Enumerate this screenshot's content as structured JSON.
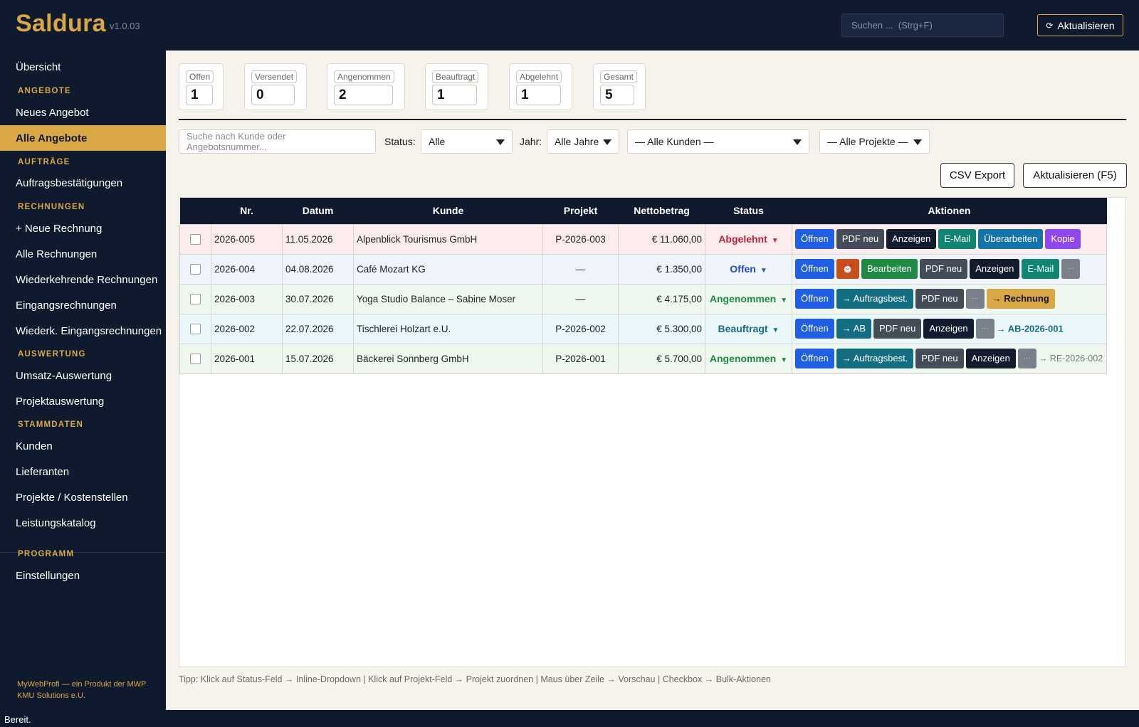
{
  "app": {
    "brand": "Saldura",
    "version": "v1.0.03"
  },
  "topbar": {
    "search_placeholder": "Suchen ...  (Strg+F)",
    "refresh_label": "Aktualisieren"
  },
  "sidebar": {
    "overview": "Übersicht",
    "sec_angebote": "ANGEBOTE",
    "new_offer": "Neues Angebot",
    "all_offers": "Alle Angebote",
    "sec_auftraege": "AUFTRÄGE",
    "order_confirmations": "Auftragsbestätigungen",
    "sec_rechnungen": "RECHNUNGEN",
    "new_invoice": "+ Neue Rechnung",
    "all_invoices": "Alle Rechnungen",
    "recurring_invoices": "Wiederkehrende Rechnungen",
    "incoming_invoices": "Eingangsrechnungen",
    "recurring_incoming": "Wiederk. Eingangsrechnungen",
    "sec_auswertung": "AUSWERTUNG",
    "revenue_report": "Umsatz-Auswertung",
    "project_report": "Projektauswertung",
    "sec_stammdaten": "STAMMDATEN",
    "customers": "Kunden",
    "suppliers": "Lieferanten",
    "projects": "Projekte / Kostenstellen",
    "catalog": "Leistungskatalog",
    "sec_programm": "PROGRAMM",
    "settings": "Einstellungen",
    "credit": "MyWebProfi — ein Produkt der MWP KMU Solutions e.U."
  },
  "stats": [
    {
      "label": "Offen",
      "value": "1"
    },
    {
      "label": "Versendet",
      "value": "0"
    },
    {
      "label": "Angenommen",
      "value": "2"
    },
    {
      "label": "Beauftragt",
      "value": "1"
    },
    {
      "label": "Abgelehnt",
      "value": "1"
    },
    {
      "label": "Gesamt",
      "value": "5"
    }
  ],
  "filters": {
    "search_placeholder": "Suche nach Kunde oder Angebotsnummer...",
    "status_label": "Status:",
    "status_value": "Alle",
    "year_label": "Jahr:",
    "year_value": "Alle Jahre",
    "customer_value": "— Alle Kunden —",
    "project_value": "— Alle Projekte —"
  },
  "toolbar": {
    "csv_export": "CSV Export",
    "refresh": "Aktualisieren  (F5)"
  },
  "table": {
    "headers": [
      "",
      "Nr.",
      "Datum",
      "Kunde",
      "Projekt",
      "Nettobetrag",
      "Status",
      "Aktionen"
    ],
    "rows": [
      {
        "nr": "2026-005",
        "date": "11.05.2026",
        "customer": "Alpenblick Tourismus GmbH",
        "project": "P-2026-003",
        "amount": "€ 11.060,00",
        "status": "Abgelehnt",
        "actions": [
          "Öffnen",
          "PDF neu",
          "Anzeigen",
          "E-Mail",
          "Überarbeiten",
          "Kopie"
        ]
      },
      {
        "nr": "2026-004",
        "date": "04.08.2026",
        "customer": "Café Mozart KG",
        "project": "—",
        "amount": "€ 1.350,00",
        "status": "Offen",
        "actions": [
          "Öffnen",
          "⏰",
          "Bearbeiten",
          "PDF neu",
          "Anzeigen",
          "E-Mail",
          "···"
        ]
      },
      {
        "nr": "2026-003",
        "date": "30.07.2026",
        "customer": "Yoga Studio Balance – Sabine Moser",
        "project": "—",
        "amount": "€ 4.175,00",
        "status": "Angenommen",
        "actions": [
          "Öffnen",
          "→ Auftragsbest.",
          "PDF neu",
          "···",
          "→ Rechnung"
        ]
      },
      {
        "nr": "2026-002",
        "date": "22.07.2026",
        "customer": "Tischlerei Holzart e.U.",
        "project": "P-2026-002",
        "amount": "€ 5.300,00",
        "status": "Beauftragt",
        "actions": [
          "Öffnen",
          "→ AB",
          "PDF neu",
          "Anzeigen",
          "···"
        ],
        "ref": "→ AB-2026-001"
      },
      {
        "nr": "2026-001",
        "date": "15.07.2026",
        "customer": "Bäckerei Sonnberg GmbH",
        "project": "P-2026-001",
        "amount": "€ 5.700,00",
        "status": "Angenommen",
        "actions": [
          "Öffnen",
          "→ Auftragsbest.",
          "PDF neu",
          "Anzeigen",
          "···"
        ],
        "ref": "→ RE-2026-002"
      }
    ]
  },
  "status_colors": {
    "Abgelehnt": "#c0243b",
    "Offen": "#1e4fc9",
    "Angenommen": "#1f8a43",
    "Beauftragt": "#146e82"
  },
  "row_colors": {
    "Abgelehnt": "#fdecee",
    "Offen": "#eef3fc",
    "Angenommen": "#eef8f0",
    "Beauftragt": "#eaf7fb"
  },
  "tip": "Tipp: Klick auf Status-Feld → Inline-Dropdown  |  Klick auf Projekt-Feld → Projekt zuordnen  |  Maus über Zeile → Vorschau  |  Checkbox → Bulk-Aktionen",
  "statusbar": "Bereit."
}
